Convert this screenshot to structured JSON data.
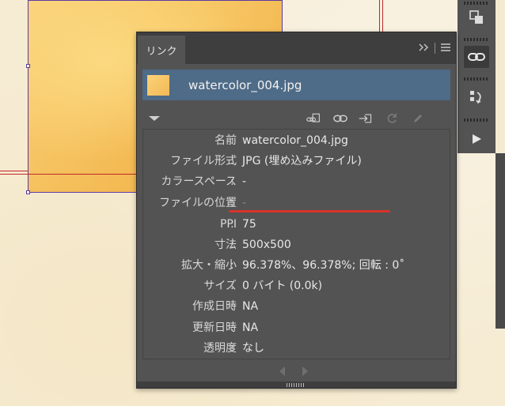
{
  "panel": {
    "tab_label": "リンク",
    "menu_icon": "hamburger-icon",
    "collapse_icon": "double-chevron-right-icon"
  },
  "selected_link": {
    "file_name": "watercolor_004.jpg"
  },
  "actions": [
    {
      "name": "relink-from-libraries-icon"
    },
    {
      "name": "relink-icon"
    },
    {
      "name": "go-to-link-icon"
    },
    {
      "name": "update-link-icon"
    },
    {
      "name": "edit-original-icon"
    }
  ],
  "info": {
    "rows": [
      {
        "label": "名前",
        "value": "watercolor_004.jpg"
      },
      {
        "label": "ファイル形式",
        "value": "JPG (埋め込みファイル)"
      },
      {
        "label": "カラースペース",
        "value": "-"
      },
      {
        "label": "ファイルの位置",
        "value": "-"
      },
      {
        "label": "PPI",
        "value": "75"
      },
      {
        "label": "寸法",
        "value": "500x500"
      },
      {
        "label": "拡大・縮小",
        "value": "96.378%、96.378%; 回転 : 0˚"
      },
      {
        "label": "サイズ",
        "value": "0 バイト (0.0k)"
      },
      {
        "label": "作成日時",
        "value": "NA"
      },
      {
        "label": "更新日時",
        "value": "NA"
      },
      {
        "label": "透明度",
        "value": "なし"
      }
    ]
  },
  "colors": {
    "panel_bg": "#535353",
    "selection": "#4e6b87",
    "highlight_underline": "#d6332a",
    "artboard_guide": "#c0282c"
  },
  "tools": [
    {
      "name": "arrange-icon"
    },
    {
      "name": "links-icon"
    },
    {
      "name": "transform-icon"
    },
    {
      "name": "play-icon"
    }
  ]
}
